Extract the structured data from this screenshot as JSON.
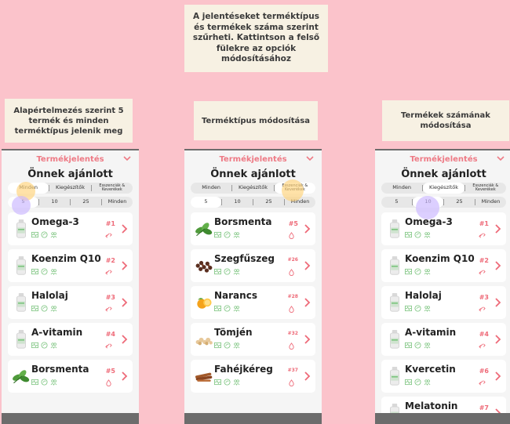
{
  "notes": {
    "main": "A jelentéseket terméktípus\nés termékek száma szerint\nszűrheti. Kattintson a felső\nfülekre az opciók\nmódosításához",
    "left": "Alapértelmezés szerint 5\ntermék és minden\ntermék­típus jelenik meg",
    "middle": "Terméktípus módosítása",
    "right": "Termékek számának\nmódosítása"
  },
  "common": {
    "header_title": "Termékjelentés",
    "section_title": "Önnek ajánlott",
    "type_options": [
      "Minden",
      "Kiegészítők",
      "Esszenciák & Keverékek"
    ],
    "count_options": [
      "5",
      "10",
      "25",
      "Minden"
    ]
  },
  "phones": [
    {
      "selected_type": 0,
      "selected_count": 0,
      "products": [
        {
          "name": "Omega-3",
          "rank": "#1",
          "kind": "bottle"
        },
        {
          "name": "Koenzim Q10",
          "rank": "#2",
          "kind": "bottle"
        },
        {
          "name": "Halolaj",
          "rank": "#3",
          "kind": "bottle"
        },
        {
          "name": "A-vitamin",
          "rank": "#4",
          "kind": "bottle"
        },
        {
          "name": "Borsmenta",
          "rank": "#5",
          "kind": "mint"
        }
      ]
    },
    {
      "selected_type": 2,
      "selected_count": 0,
      "products": [
        {
          "name": "Borsmenta",
          "rank": "#5",
          "kind": "mint"
        },
        {
          "name": "Szegfűszeg",
          "rank": "#26",
          "kind": "clove"
        },
        {
          "name": "Narancs",
          "rank": "#28",
          "kind": "orange"
        },
        {
          "name": "Tömjén",
          "rank": "#32",
          "kind": "frank"
        },
        {
          "name": "Fahéjkéreg",
          "rank": "#37",
          "kind": "cinnamon"
        }
      ]
    },
    {
      "selected_type": 1,
      "selected_count": 1,
      "products": [
        {
          "name": "Omega-3",
          "rank": "#1",
          "kind": "bottle"
        },
        {
          "name": "Koenzim Q10",
          "rank": "#2",
          "kind": "bottle"
        },
        {
          "name": "Halolaj",
          "rank": "#3",
          "kind": "bottle"
        },
        {
          "name": "A-vitamin",
          "rank": "#4",
          "kind": "bottle"
        },
        {
          "name": "Kvercetin",
          "rank": "#6",
          "kind": "bottle"
        },
        {
          "name": "Melatonin",
          "rank": "#7",
          "kind": "bottle"
        }
      ]
    }
  ],
  "colors": {
    "background": "#fbc3cb",
    "accent": "#ee7a85",
    "green": "#7cc47f",
    "highlight_yellow": "#ffd27a",
    "highlight_purple": "#c9b6ff"
  }
}
